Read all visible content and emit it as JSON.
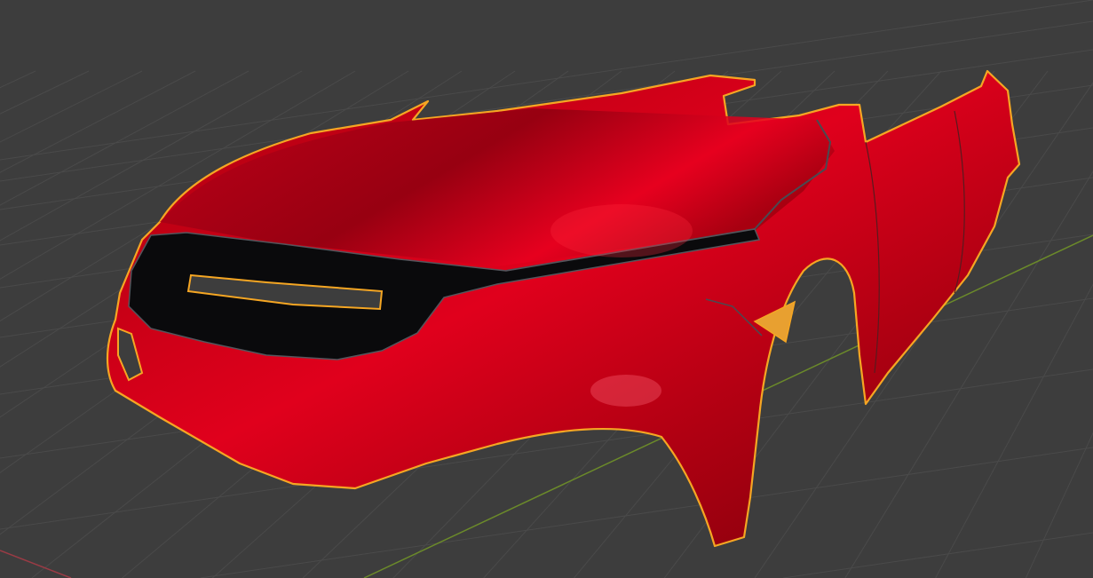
{
  "viewport": {
    "background_color": "#3d3d3d",
    "grid_color": "#4a4a4a",
    "x_axis_color": "#9a3b45",
    "y_axis_color": "#6b8a2a",
    "selection_outline_color": "#f5a623",
    "object": {
      "body_color": "#d0001a",
      "grille_color": "#0a0a0c",
      "selected": true
    }
  }
}
